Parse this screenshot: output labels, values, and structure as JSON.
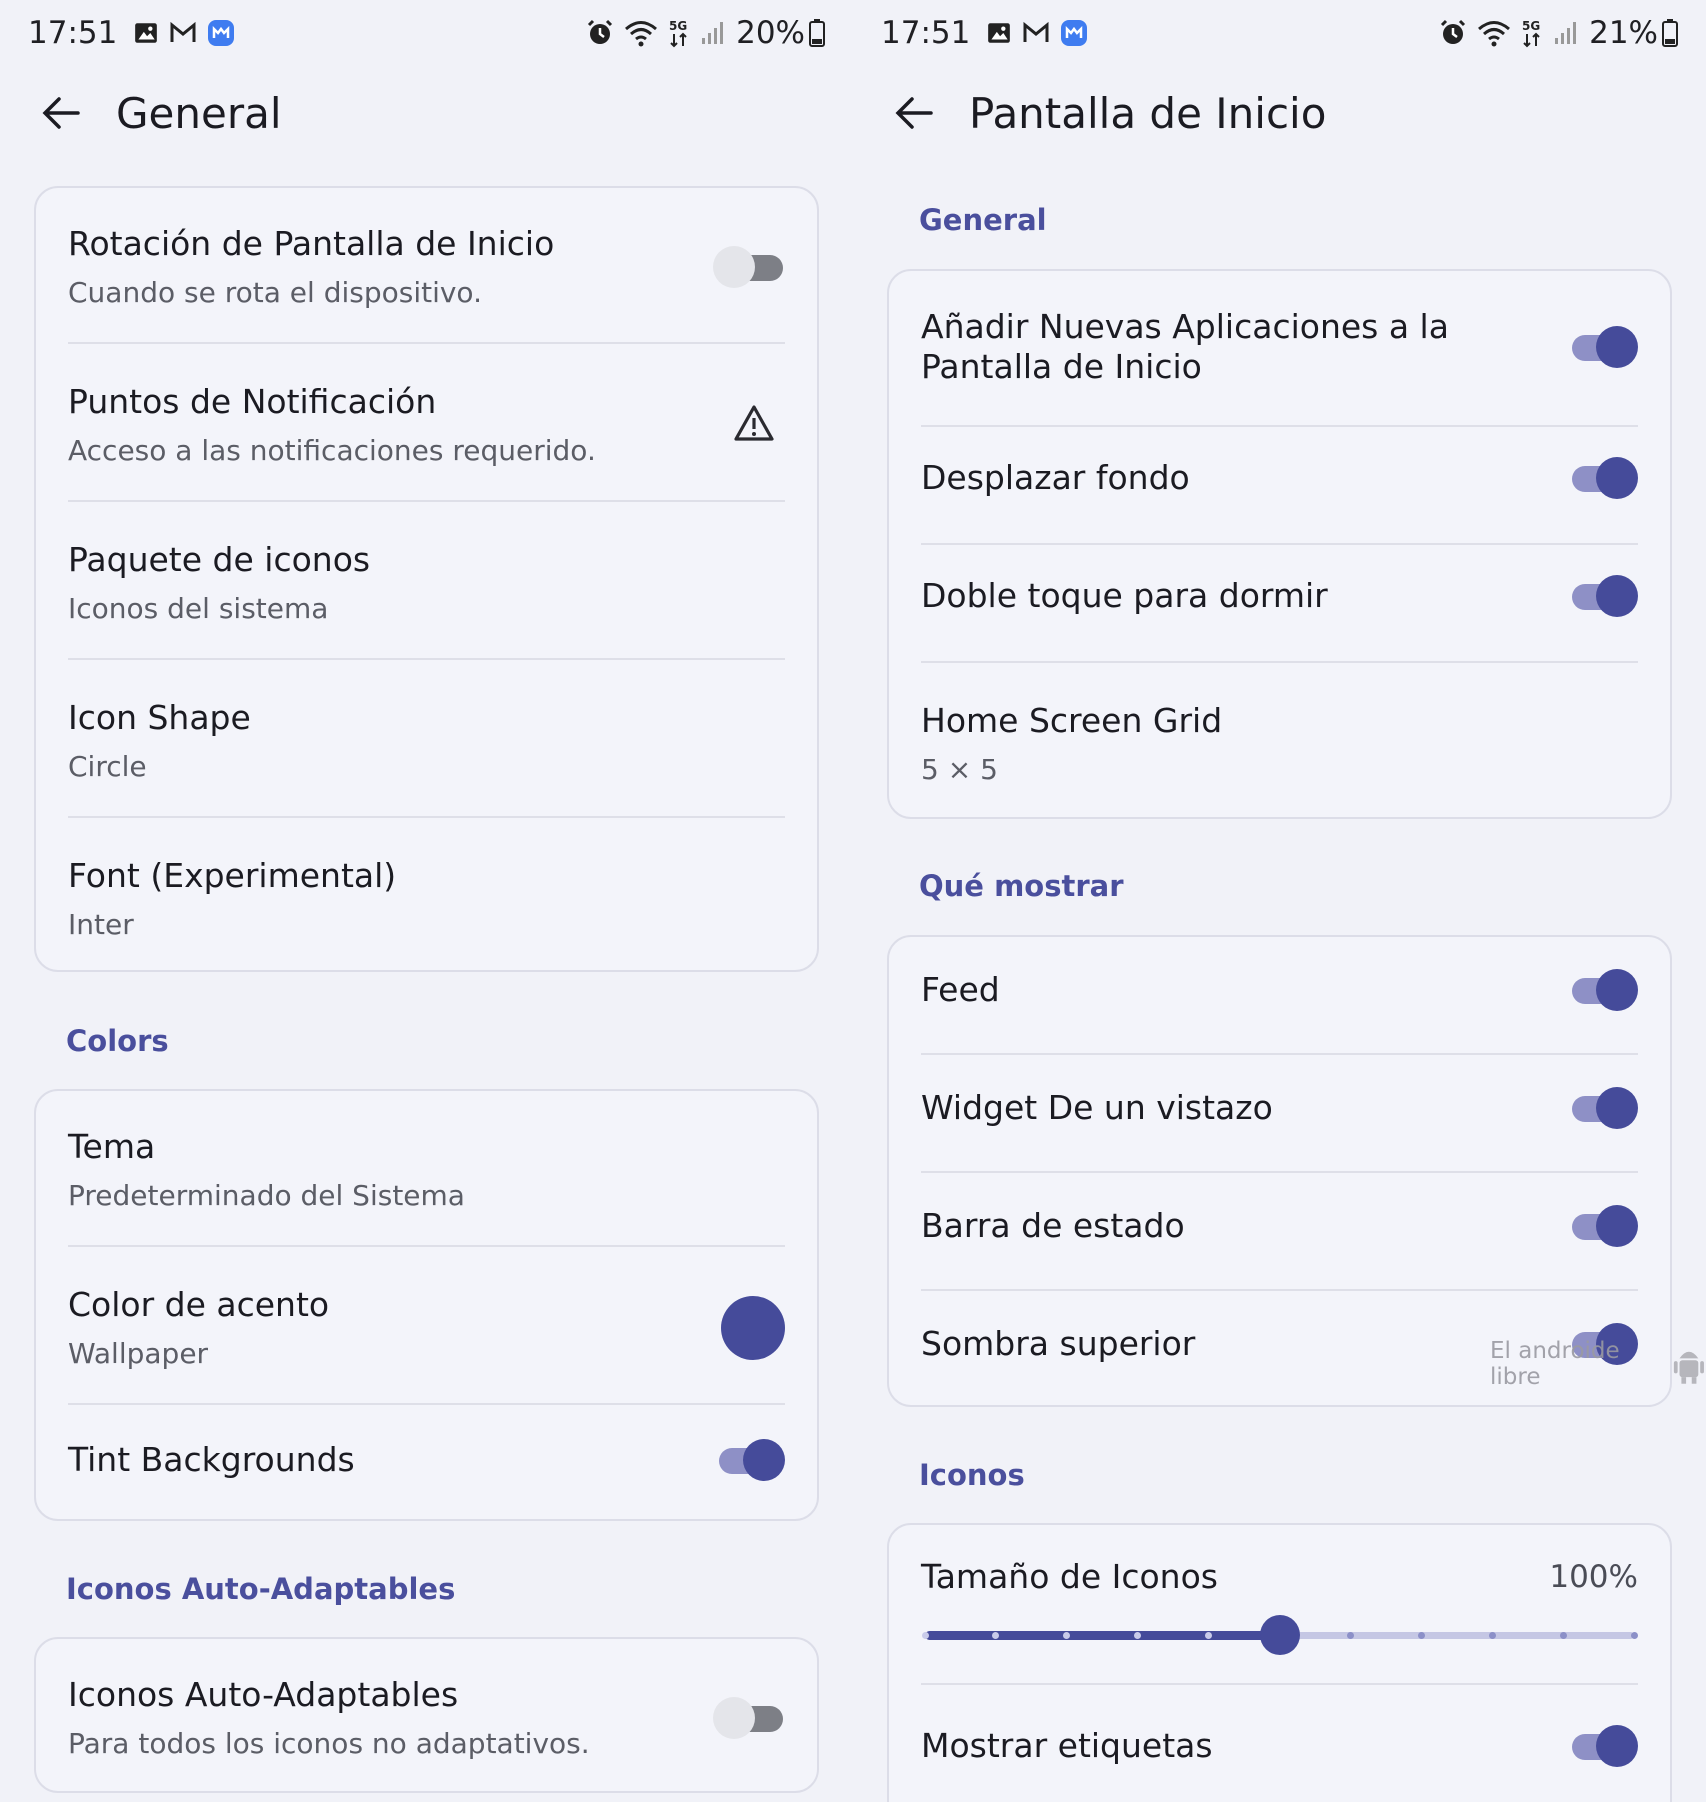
{
  "colors": {
    "background": "#f1f2f8",
    "accent": "#454b9a",
    "section_title": "#4a4f9d",
    "switch_on_track": "#8e90c6",
    "switch_off_track": "#7d7f86"
  },
  "left": {
    "status_bar": {
      "time": "17:51",
      "battery": "20%",
      "network": "5G",
      "icons": [
        "gallery-icon",
        "gmail-icon",
        "messenger-icon",
        "alarm-icon",
        "wifi-icon",
        "5g-icon",
        "signal-icon",
        "battery-icon"
      ]
    },
    "app_bar": {
      "back_icon": "arrow-left-icon",
      "title": "General"
    },
    "general_card": {
      "rows": [
        {
          "title": "Rotación de Pantalla de Inicio",
          "subtitle": "Cuando se rota el dispositivo.",
          "control": "switch",
          "on": false
        },
        {
          "title": "Puntos de Notificación",
          "subtitle": "Acceso a las notificaciones requerido.",
          "control": "warning-icon"
        },
        {
          "title": "Paquete de iconos",
          "subtitle": "Iconos del sistema"
        },
        {
          "title": "Icon Shape",
          "subtitle": "Circle"
        },
        {
          "title": "Font (Experimental)",
          "subtitle": "Inter"
        }
      ]
    },
    "colors_section": {
      "title": "Colors",
      "rows": [
        {
          "title": "Tema",
          "subtitle": "Predeterminado del Sistema"
        },
        {
          "title": "Color de acento",
          "subtitle": "Wallpaper",
          "control": "color-swatch",
          "color": "#454b9a"
        },
        {
          "title": "Tint Backgrounds",
          "control": "switch",
          "on": true
        }
      ]
    },
    "adaptive_section": {
      "title": "Iconos Auto-Adaptables",
      "rows": [
        {
          "title": "Iconos Auto-Adaptables",
          "subtitle": "Para todos los iconos no adaptativos.",
          "control": "switch",
          "on": false
        }
      ]
    }
  },
  "right": {
    "status_bar": {
      "time": "17:51",
      "battery": "21%",
      "network": "5G",
      "icons": [
        "gallery-icon",
        "gmail-icon",
        "messenger-icon",
        "alarm-icon",
        "wifi-icon",
        "5g-icon",
        "signal-icon",
        "battery-icon"
      ]
    },
    "app_bar": {
      "back_icon": "arrow-left-icon",
      "title": "Pantalla de Inicio"
    },
    "general_section": {
      "title": "General",
      "rows": [
        {
          "title_line1": "Añadir Nuevas Aplicaciones a la",
          "title_line2": "Pantalla de Inicio",
          "control": "switch",
          "on": true
        },
        {
          "title": "Desplazar fondo",
          "control": "switch",
          "on": true
        },
        {
          "title": "Doble toque para dormir",
          "control": "switch",
          "on": true
        },
        {
          "title": "Home Screen Grid",
          "subtitle": "5 × 5"
        }
      ]
    },
    "show_section": {
      "title": "Qué mostrar",
      "rows": [
        {
          "title": "Feed",
          "control": "switch",
          "on": true
        },
        {
          "title": "Widget De un vistazo",
          "control": "switch",
          "on": true
        },
        {
          "title": "Barra de estado",
          "control": "switch",
          "on": true
        },
        {
          "title": "Sombra superior",
          "control": "switch",
          "on": true
        }
      ]
    },
    "icons_section": {
      "title": "Iconos",
      "icon_size": {
        "title": "Tamaño de Iconos",
        "value_label": "100%",
        "value_fraction": 0.5,
        "steps": 11
      },
      "show_labels": {
        "title": "Mostrar etiquetas",
        "control": "switch",
        "on": true
      }
    },
    "watermark": {
      "text": "El androide libre"
    }
  }
}
